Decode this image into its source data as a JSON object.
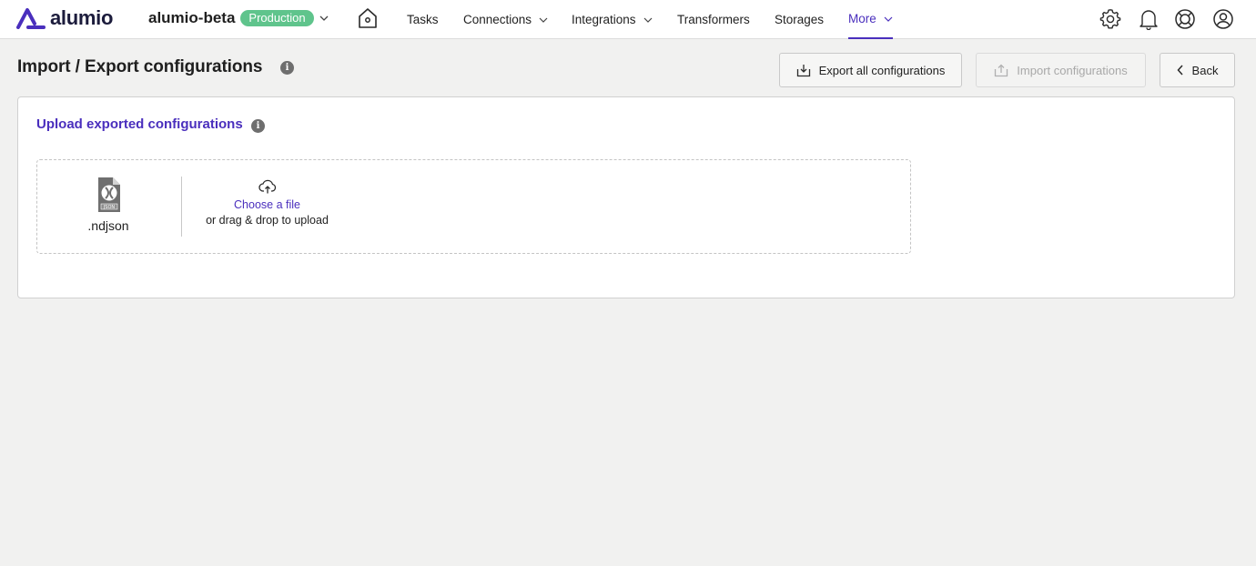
{
  "app": {
    "logo_text": "alumio"
  },
  "environment": {
    "name": "alumio-beta",
    "badge": "Production",
    "badge_color": "#5fc48c"
  },
  "nav": {
    "home_icon": "home-icon",
    "items": [
      {
        "label": "Tasks",
        "has_dropdown": false,
        "active": false
      },
      {
        "label": "Connections",
        "has_dropdown": true,
        "active": false
      },
      {
        "label": "Integrations",
        "has_dropdown": true,
        "active": false
      },
      {
        "label": "Transformers",
        "has_dropdown": false,
        "active": false
      },
      {
        "label": "Storages",
        "has_dropdown": false,
        "active": false
      },
      {
        "label": "More",
        "has_dropdown": true,
        "active": true
      }
    ],
    "right_icons": [
      "gear-icon",
      "bell-icon",
      "help-icon",
      "user-icon"
    ]
  },
  "page": {
    "title": "Import / Export configurations"
  },
  "actions": {
    "export_label": "Export all configurations",
    "import_label": "Import configurations",
    "back_label": "Back"
  },
  "upload": {
    "title": "Upload exported configurations",
    "file_type": ".ndjson",
    "choose_label": "Choose a file",
    "drag_label": "or drag & drop to upload"
  },
  "colors": {
    "accent": "#4a2fbd",
    "background": "#f1f1f0"
  }
}
